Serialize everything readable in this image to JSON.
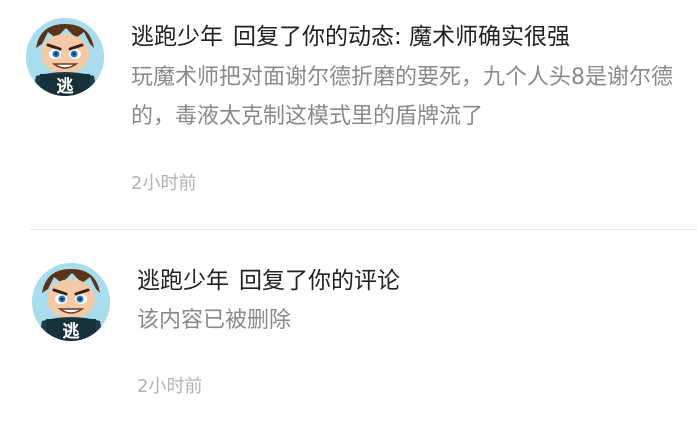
{
  "notifications": [
    {
      "username": "逃跑少年",
      "action": "回复了你的动态: 魔术师确实很强",
      "excerpt": "玩魔术师把对面谢尔德折磨的要死，九个人头8是谢尔德的，毒液太克制这模式里的盾牌流了",
      "time": "2小时前",
      "avatar": {
        "icon": "cartoon-boy-avatar-icon",
        "badge_text": "逃"
      }
    },
    {
      "username": "逃跑少年",
      "action": "回复了你的评论",
      "excerpt": "该内容已被删除",
      "time": "2小时前",
      "avatar": {
        "icon": "cartoon-boy-avatar-icon",
        "badge_text": "逃"
      }
    }
  ],
  "colors": {
    "text_primary": "#222222",
    "text_secondary": "#8a8a8a",
    "text_time": "#b3b3b3",
    "divider": "#ececec"
  }
}
